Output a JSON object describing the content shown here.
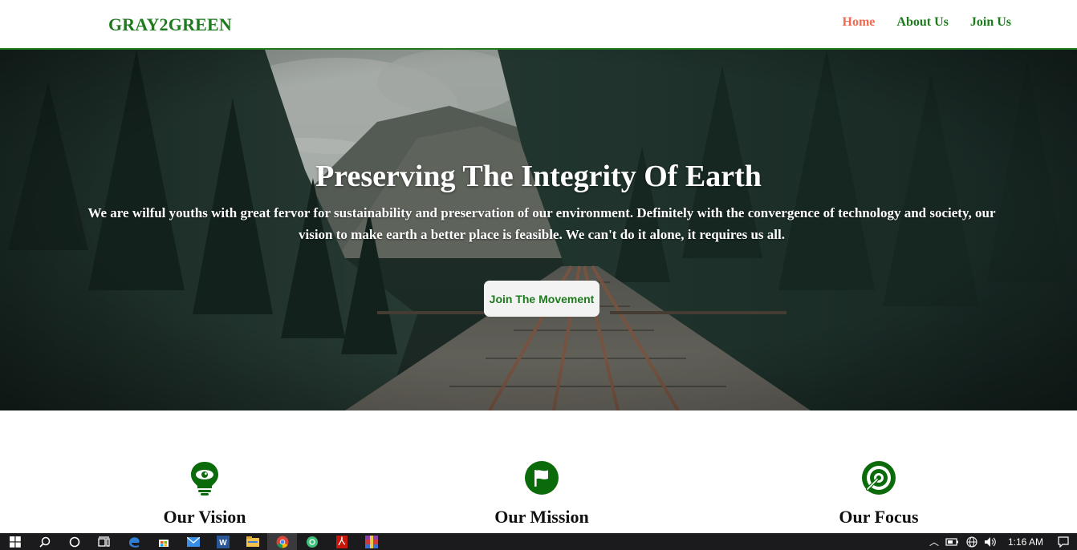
{
  "header": {
    "brand": "GRAY2GREEN",
    "nav": [
      {
        "label": "Home",
        "active": true
      },
      {
        "label": "About Us",
        "active": false
      },
      {
        "label": "Join Us",
        "active": false
      }
    ]
  },
  "hero": {
    "title": "Preserving The Integrity Of Earth",
    "text": "We are wilful youths with great fervor for sustainability and preservation of our environment. Definitely with the convergence of technology and society, our vision to make earth a better place is feasible. We can't do it alone, it requires us all.",
    "cta_label": "Join The Movement"
  },
  "features": [
    {
      "label": "Our Vision",
      "icon": "lightbulb-eye-icon"
    },
    {
      "label": "Our Mission",
      "icon": "flag-icon"
    },
    {
      "label": "Our Focus",
      "icon": "target-icon"
    }
  ],
  "taskbar": {
    "time": "1:16 AM",
    "apps": [
      "start-icon",
      "search-icon",
      "cortana-icon",
      "task-view-icon",
      "edge-icon",
      "store-icon",
      "mail-icon",
      "word-icon",
      "file-explorer-icon",
      "chrome-icon",
      "app-icon",
      "acrobat-icon",
      "winrar-icon"
    ]
  },
  "colors": {
    "brand_green": "#1d7a1d",
    "active_nav": "#f06a4f",
    "icon_green": "#0b6b0b"
  }
}
